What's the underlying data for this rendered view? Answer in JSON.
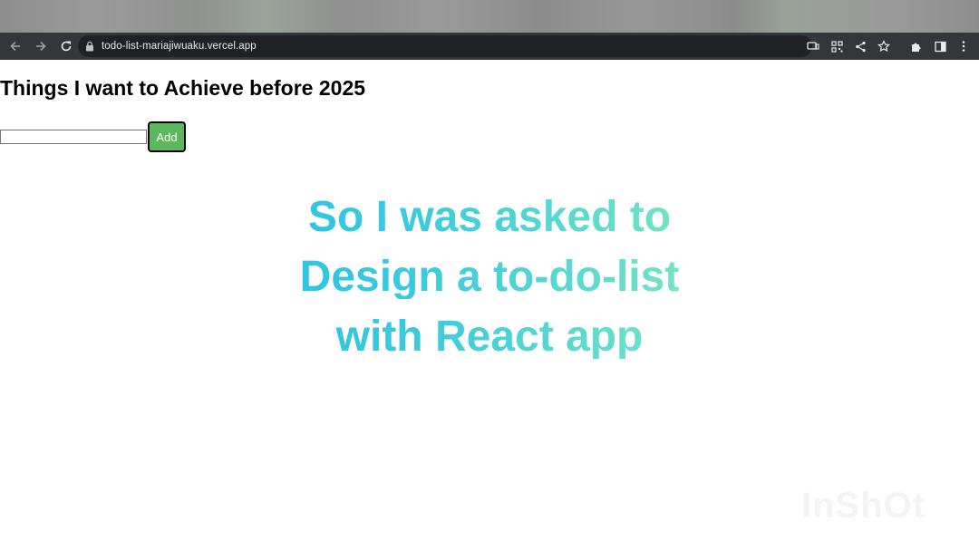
{
  "browser": {
    "url": "todo-list-mariajiwuaku.vercel.app",
    "icons": [
      "back-arrow-icon",
      "forward-arrow-icon",
      "reload-icon",
      "lock-icon",
      "cast-icon",
      "qr-code-icon",
      "share-icon",
      "bookmark-star-icon",
      "extensions-puzzle-icon",
      "side-panel-icon",
      "kebab-menu-icon"
    ]
  },
  "page": {
    "title": "Things I want to Achieve before 2025",
    "input_value": "",
    "add_label": "Add"
  },
  "overlay": {
    "lines": [
      "So I was asked to",
      "Design a to-do-list",
      "with React app"
    ]
  },
  "watermark": "InShOt",
  "colors": {
    "chrome_bar": "#35363a",
    "omnibox": "#202124",
    "add_button": "#5cb85c",
    "gradient_start": "#22bfe6",
    "gradient_end": "#8ef0bc"
  }
}
